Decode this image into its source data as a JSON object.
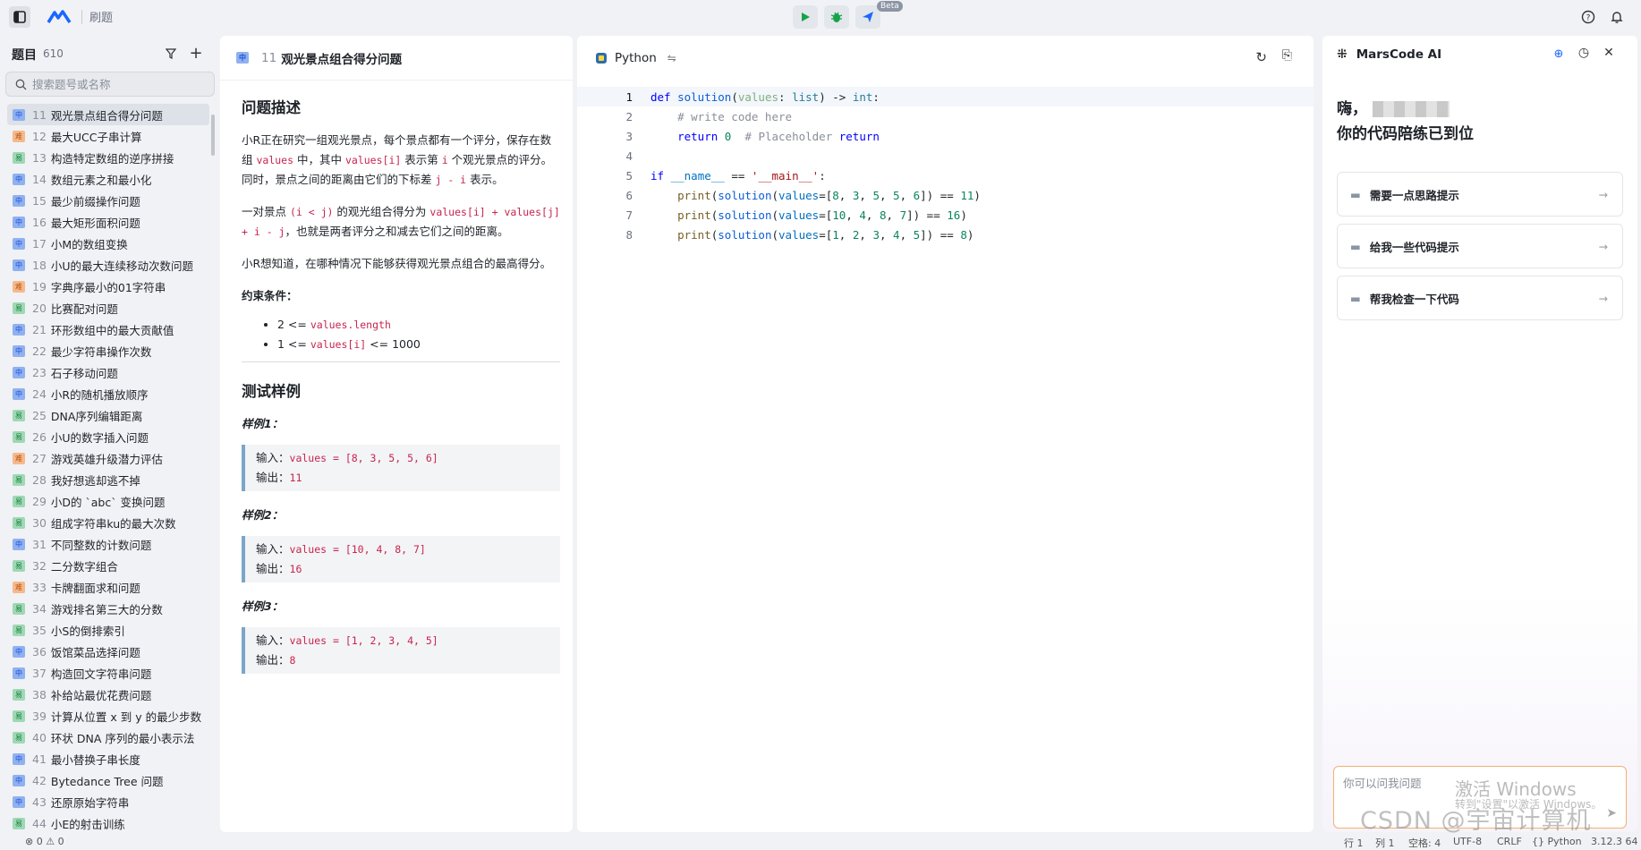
{
  "app": {
    "title": "刷题"
  },
  "toolbar": {
    "beta": "Beta"
  },
  "sidebar": {
    "heading": "题目",
    "count": "610",
    "search_placeholder": "搜索题号或名称",
    "items": [
      {
        "d": "中",
        "n": "11",
        "t": "观光景点组合得分问题"
      },
      {
        "d": "难",
        "n": "12",
        "t": "最大UCC子串计算"
      },
      {
        "d": "易",
        "n": "13",
        "t": "构造特定数组的逆序拼接"
      },
      {
        "d": "中",
        "n": "14",
        "t": "数组元素之和最小化"
      },
      {
        "d": "中",
        "n": "15",
        "t": "最少前缀操作问题"
      },
      {
        "d": "中",
        "n": "16",
        "t": "最大矩形面积问题"
      },
      {
        "d": "中",
        "n": "17",
        "t": "小M的数组变换"
      },
      {
        "d": "中",
        "n": "18",
        "t": "小U的最大连续移动次数问题"
      },
      {
        "d": "难",
        "n": "19",
        "t": "字典序最小的01字符串"
      },
      {
        "d": "易",
        "n": "20",
        "t": "比赛配对问题"
      },
      {
        "d": "中",
        "n": "21",
        "t": "环形数组中的最大贡献值"
      },
      {
        "d": "中",
        "n": "22",
        "t": "最少字符串操作次数"
      },
      {
        "d": "中",
        "n": "23",
        "t": "石子移动问题"
      },
      {
        "d": "中",
        "n": "24",
        "t": "小R的随机播放顺序"
      },
      {
        "d": "易",
        "n": "25",
        "t": "DNA序列编辑距离"
      },
      {
        "d": "易",
        "n": "26",
        "t": "小U的数字插入问题"
      },
      {
        "d": "难",
        "n": "27",
        "t": "游戏英雄升级潜力评估"
      },
      {
        "d": "易",
        "n": "28",
        "t": "我好想逃却逃不掉"
      },
      {
        "d": "易",
        "n": "29",
        "t": "小D的 `abc` 变换问题"
      },
      {
        "d": "易",
        "n": "30",
        "t": "组成字符串ku的最大次数"
      },
      {
        "d": "中",
        "n": "31",
        "t": "不同整数的计数问题"
      },
      {
        "d": "易",
        "n": "32",
        "t": "二分数字组合"
      },
      {
        "d": "难",
        "n": "33",
        "t": "卡牌翻面求和问题"
      },
      {
        "d": "易",
        "n": "34",
        "t": "游戏排名第三大的分数"
      },
      {
        "d": "易",
        "n": "35",
        "t": "小S的倒排索引"
      },
      {
        "d": "中",
        "n": "36",
        "t": "饭馆菜品选择问题"
      },
      {
        "d": "中",
        "n": "37",
        "t": "构造回文字符串问题"
      },
      {
        "d": "易",
        "n": "38",
        "t": "补给站最优花费问题"
      },
      {
        "d": "易",
        "n": "39",
        "t": "计算从位置 x 到 y 的最少步数"
      },
      {
        "d": "易",
        "n": "40",
        "t": "环状 DNA 序列的最小表示法"
      },
      {
        "d": "中",
        "n": "41",
        "t": "最小替换子串长度"
      },
      {
        "d": "中",
        "n": "42",
        "t": "Bytedance Tree 问题"
      },
      {
        "d": "中",
        "n": "43",
        "t": "还原原始字符串"
      },
      {
        "d": "易",
        "n": "44",
        "t": "小E的射击训练"
      }
    ]
  },
  "problem": {
    "tab_diff": "中",
    "tab_num": "11",
    "tab_title": "观光景点组合得分问题",
    "desc_heading": "问题描述",
    "p1": [
      "小R正在研究一组观光景点，每个景点都有一个评分，保存在数组 ",
      "values",
      " 中，其中 ",
      "values[i]",
      " 表示第 ",
      "i",
      " 个观光景点的评分。同时，景点之间的距离由它们的下标差 ",
      "j - i",
      " 表示。"
    ],
    "p2": [
      "一对景点 ",
      "(i < j)",
      " 的观光组合得分为 ",
      "values[i] + values[j] + i - j",
      "，也就是两者评分之和减去它们之间的距离。"
    ],
    "p3": "小R想知道，在哪种情况下能够获得观光景点组合的最高得分。",
    "constraints_title": "约束条件：",
    "constraints": [
      [
        "2 <= ",
        "values.length",
        ""
      ],
      [
        "1 <= ",
        "values[i]",
        " <= 1000"
      ]
    ],
    "examples_heading": "测试样例",
    "examples": [
      {
        "title": "样例1：",
        "in_label": "输入：",
        "in": "values = [8, 3, 5, 5, 6]",
        "out_label": "输出：",
        "out": "11"
      },
      {
        "title": "样例2：",
        "in_label": "输入：",
        "in": "values = [10, 4, 8, 7]",
        "out_label": "输出：",
        "out": "16"
      },
      {
        "title": "样例3：",
        "in_label": "输入：",
        "in": "values = [1, 2, 3, 4, 5]",
        "out_label": "输出：",
        "out": "8"
      }
    ]
  },
  "editor": {
    "language": "Python",
    "code_lines": [
      "def solution(values: list) -> int:",
      "    # write code here",
      "    return 0  # Placeholder return",
      "",
      "if __name__ == '__main__':",
      "    print(solution(values=[8, 3, 5, 5, 6]) == 11)",
      "    print(solution(values=[10, 4, 8, 7]) == 16)",
      "    print(solution(values=[1, 2, 3, 4, 5]) == 8)"
    ]
  },
  "ai": {
    "title": "MarsCode AI",
    "greeting1": "嗨，",
    "greeting2": "你的代码陪练已到位",
    "suggestions": [
      "需要一点思路提示",
      "给我一些代码提示",
      "帮我检查一下代码"
    ],
    "input_placeholder": "你可以问我问题"
  },
  "statusbar": {
    "left": "⊗ 0 ⚠ 0",
    "line": "行 1",
    "col": "列 1",
    "spaces": "空格: 4",
    "encoding": "UTF-8",
    "eol": "CRLF",
    "lang": "{} Python",
    "version": "3.12.3 64"
  },
  "watermarks": {
    "win1": "激活 Windows",
    "win2": "转到\"设置\"以激活 Windows。",
    "csdn": "CSDN @宇宙计算机"
  },
  "colors": {
    "accent": "#1b66ff",
    "run": "#16a34a",
    "chat_border": "#f0b36a"
  }
}
